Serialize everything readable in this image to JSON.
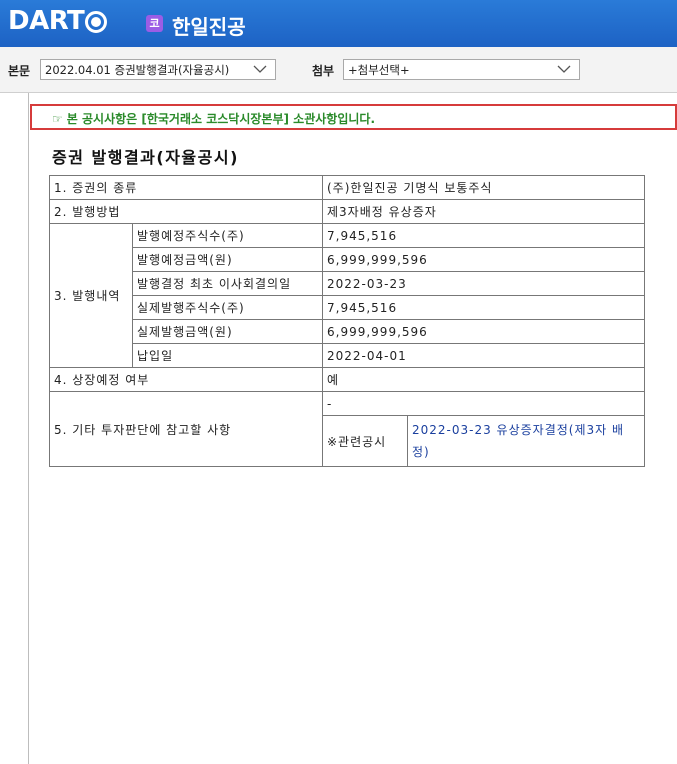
{
  "header": {
    "logo_text": "DART",
    "company_badge": "코",
    "company_name": "한일진공"
  },
  "toolbar": {
    "main_label": "본문",
    "main_select_value": "2022.04.01  증권발행결과(자율공시)",
    "attach_label": "첨부",
    "attach_select_value": "+첨부선택+"
  },
  "notice": {
    "text": "본 공시사항은 [한국거래소 코스닥시장본부] 소관사항입니다."
  },
  "document": {
    "title": "증권 발행결과(자율공시)",
    "rows": {
      "r1_label": "1. 증권의 종류",
      "r1_value": "(주)한일진공 기명식 보통주식",
      "r2_label": "2. 발행방법",
      "r2_value": "제3자배정 유상증자",
      "r3_label": "3. 발행내역",
      "r3_items": [
        {
          "label": "발행예정주식수(주)",
          "value": "7,945,516"
        },
        {
          "label": "발행예정금액(원)",
          "value": "6,999,999,596"
        },
        {
          "label": "발행결정 최초 이사회결의일",
          "value": "2022-03-23"
        },
        {
          "label": "실제발행주식수(주)",
          "value": "7,945,516"
        },
        {
          "label": "실제발행금액(원)",
          "value": "6,999,999,596"
        },
        {
          "label": "납입일",
          "value": "2022-04-01"
        }
      ],
      "r4_label": "4. 상장예정 여부",
      "r4_value": "예",
      "r5_label": "5. 기타 투자판단에 참고할 사항",
      "r5_value": "-",
      "related_label": "※관련공시",
      "related_link": "2022-03-23 유상증자결정(제3자 배정)"
    }
  },
  "colors": {
    "header_blue": "#1d62c4",
    "notice_border": "#d63b3b",
    "notice_text": "#2a8a2a",
    "link": "#1a3f9e",
    "badge": "#9b5de5"
  }
}
